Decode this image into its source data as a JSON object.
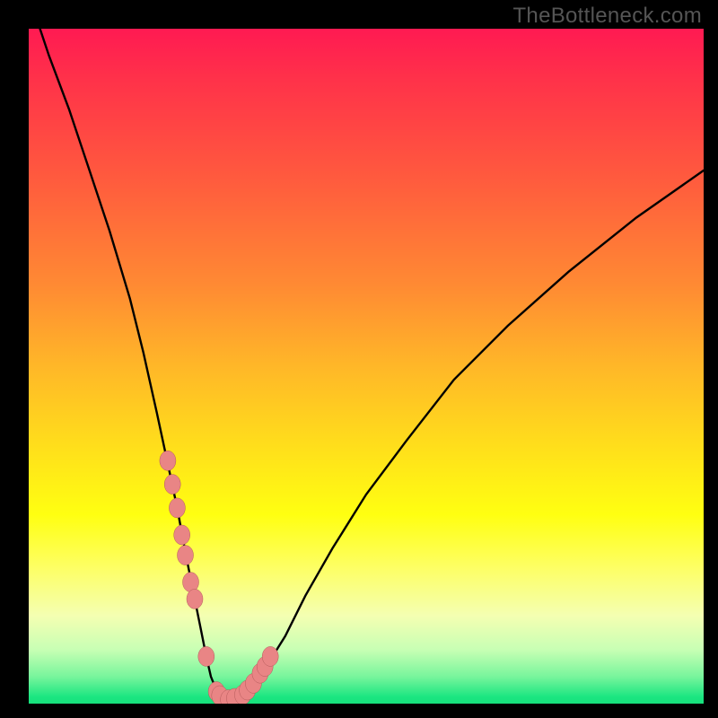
{
  "watermark": "TheBottleneck.com",
  "colors": {
    "background": "#000000",
    "curve": "#000000",
    "dot_fill": "#e98585",
    "dot_stroke": "#b35a5a",
    "watermark": "#555555"
  },
  "chart_data": {
    "type": "line",
    "title": "",
    "xlabel": "",
    "ylabel": "",
    "xlim": [
      0,
      100
    ],
    "ylim": [
      0,
      100
    ],
    "grid": false,
    "curve": {
      "x": [
        0,
        3,
        6,
        9,
        12,
        15,
        17,
        19,
        20.5,
        22,
        23.3,
        24.5,
        25.5,
        26.3,
        27,
        27.8,
        28.5,
        29.1,
        30.5,
        32,
        33.5,
        35.5,
        38,
        41,
        45,
        50,
        56,
        63,
        71,
        80,
        90,
        100
      ],
      "y": [
        105,
        96,
        88,
        79,
        70,
        60,
        52,
        43,
        36,
        29,
        22,
        16,
        11,
        7,
        4,
        2,
        1,
        0.5,
        0.6,
        1.5,
        3,
        6,
        10,
        16,
        23,
        31,
        39,
        48,
        56,
        64,
        72,
        79
      ]
    },
    "dots": {
      "x": [
        20.6,
        21.3,
        22.0,
        22.7,
        23.2,
        24.0,
        24.6,
        26.3,
        27.8,
        28.3,
        29.6,
        30.5,
        31.7,
        32.4,
        33.3,
        34.3,
        35.0,
        35.8
      ],
      "y": [
        36.0,
        32.5,
        29.0,
        25.0,
        22.0,
        18.0,
        15.5,
        7.0,
        1.8,
        1.2,
        0.6,
        0.8,
        1.3,
        2.0,
        3.0,
        4.5,
        5.5,
        7.0
      ]
    },
    "flat_footer_color_band": true
  }
}
